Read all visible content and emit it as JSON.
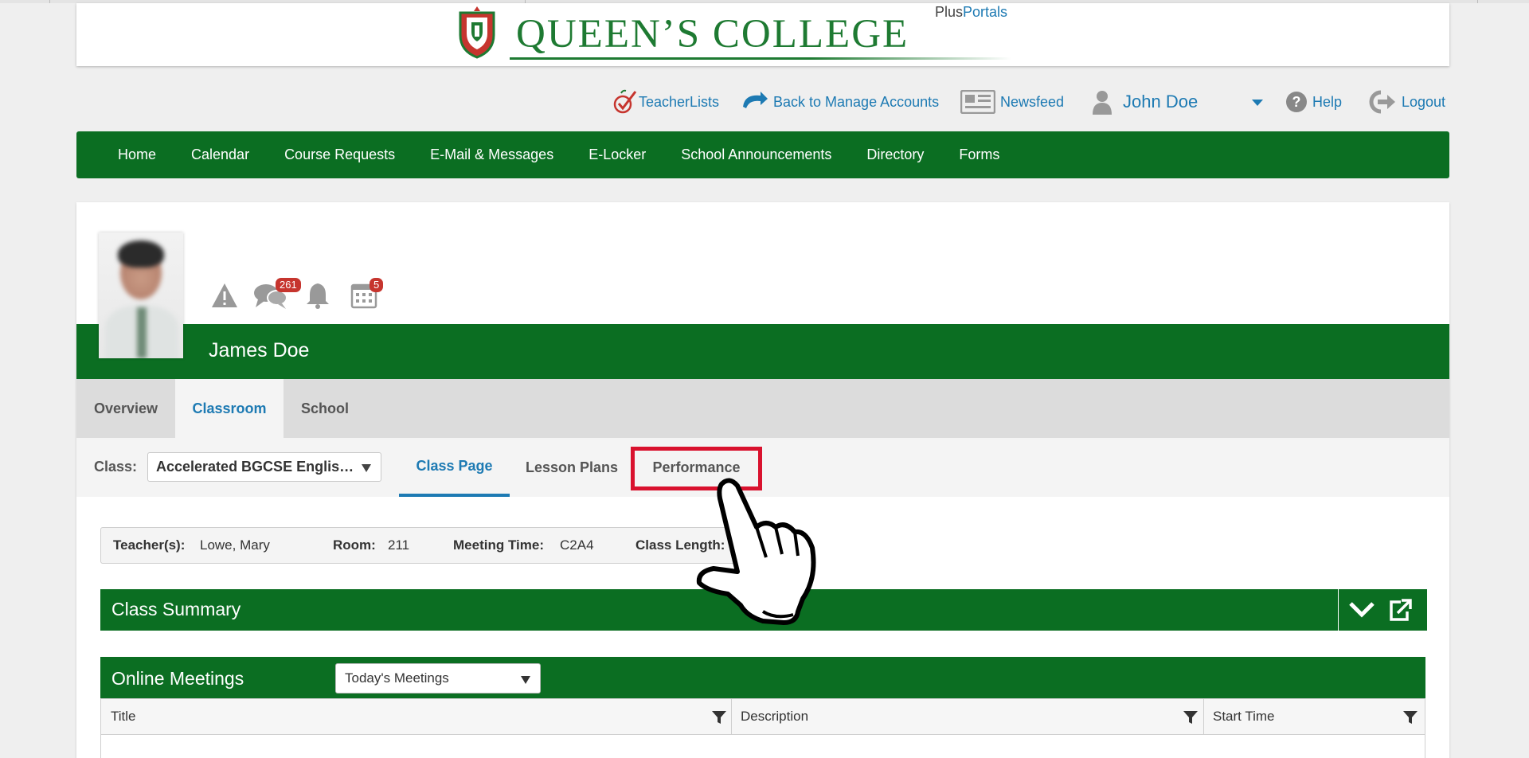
{
  "banner": {
    "school_name": "QUEEN’S COLLEGE",
    "brand_plus": "Plus",
    "brand_portals": "Portals"
  },
  "util": {
    "teacherlists": "TeacherLists",
    "back": "Back to Manage Accounts",
    "newsfeed": "Newsfeed",
    "user": "John Doe",
    "help": "Help",
    "logout": "Logout"
  },
  "nav": [
    "Home",
    "Calendar",
    "Course Requests",
    "E-Mail & Messages",
    "E-Locker",
    "School Announcements",
    "Directory",
    "Forms"
  ],
  "alerts": {
    "messages_count": "261",
    "calendar_count": "5"
  },
  "student": {
    "name": "James Doe"
  },
  "tabs": [
    "Overview",
    "Classroom",
    "School"
  ],
  "class_bar": {
    "label": "Class:",
    "selected": "Accelerated BGCSE Englis…",
    "subtabs": [
      "Class Page",
      "Lesson Plans",
      "Performance"
    ]
  },
  "info": {
    "teacher_label": "Teacher(s):",
    "teacher": "Lowe, Mary",
    "room_label": "Room:",
    "room": "211",
    "meeting_label": "Meeting Time:",
    "meeting": "C2A4",
    "length_label": "Class Length:"
  },
  "class_summary": {
    "title": "Class Summary"
  },
  "online_meetings": {
    "title": "Online Meetings",
    "filter": "Today's Meetings",
    "columns": [
      "Title",
      "Description",
      "Start Time"
    ]
  },
  "colors": {
    "green": "#0b6e22",
    "link_blue": "#1d7ab3",
    "badge_red": "#c6352e",
    "highlight_red": "#d9122e"
  }
}
